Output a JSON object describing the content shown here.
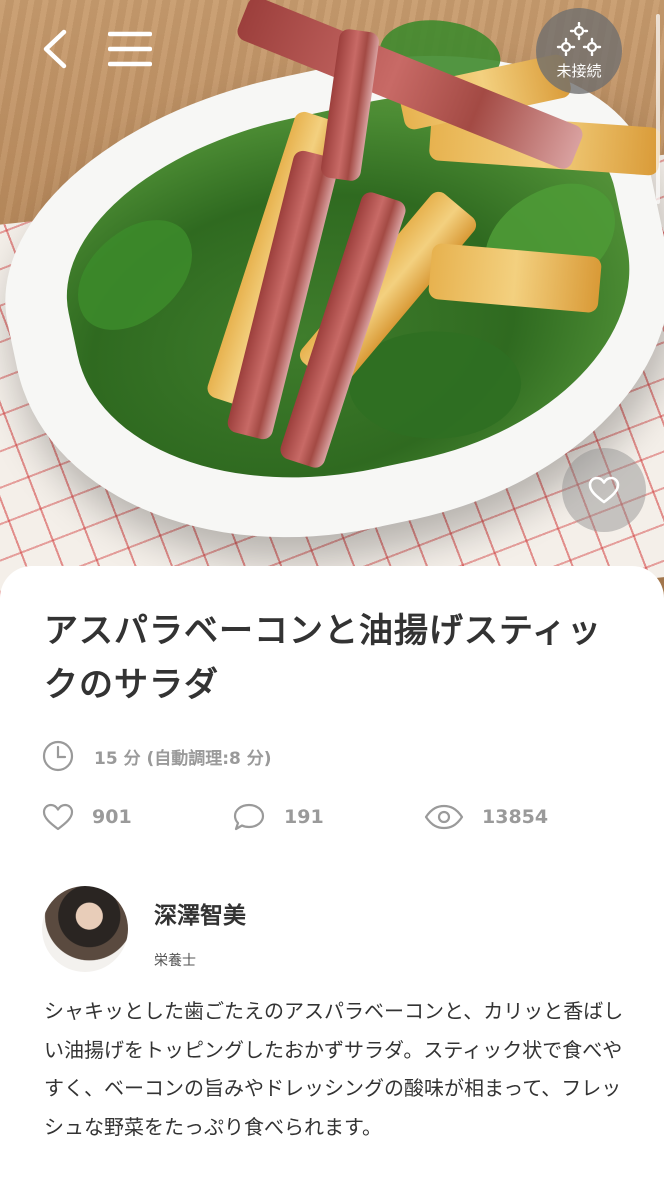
{
  "header": {
    "back_icon": "chevron-left-icon",
    "menu_icon": "hamburger-menu-icon",
    "connection": {
      "icon": "gears-icon",
      "label": "未接続"
    },
    "favorite_icon": "heart-outline-icon"
  },
  "recipe": {
    "title": "アスパラベーコンと油揚げスティックのサラダ",
    "time": "15 分 (自動調理:8 分)",
    "likes": "901",
    "comments": "191",
    "views": "13854",
    "description": "シャキッとした歯ごたえのアスパラベーコンと、カリッと香ばしい油揚げをトッピングしたおかずサラダ。スティック状で食べやすく、ベーコンの旨みやドレッシングの酸味が相まって、フレッシュな野菜をたっぷり食べられます。"
  },
  "author": {
    "name": "深澤智美",
    "role": "栄養士"
  },
  "colors": {
    "text": "#333333",
    "muted": "#9a9a9a",
    "badge_bg": "#6e6e6e"
  }
}
